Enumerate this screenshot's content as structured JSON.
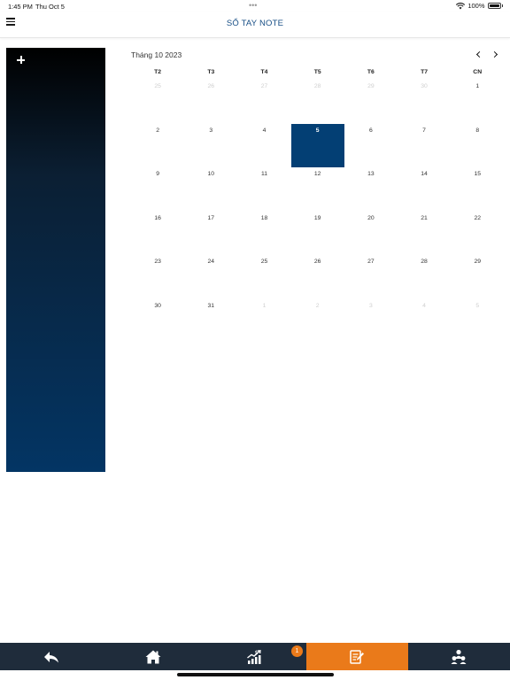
{
  "status_bar": {
    "time": "1:45 PM",
    "date": "Thu Oct 5",
    "battery": "100%"
  },
  "header": {
    "title": "SỔ TAY NOTE"
  },
  "calendar": {
    "month_label": "Tháng 10 2023",
    "weekdays": [
      "T2",
      "T3",
      "T4",
      "T5",
      "T6",
      "T7",
      "CN"
    ],
    "days": [
      {
        "d": "25",
        "muted": true
      },
      {
        "d": "26",
        "muted": true
      },
      {
        "d": "27",
        "muted": true
      },
      {
        "d": "28",
        "muted": true
      },
      {
        "d": "29",
        "muted": true
      },
      {
        "d": "30",
        "muted": true
      },
      {
        "d": "1"
      },
      {
        "d": "2"
      },
      {
        "d": "3"
      },
      {
        "d": "4"
      },
      {
        "d": "5",
        "selected": true
      },
      {
        "d": "6"
      },
      {
        "d": "7"
      },
      {
        "d": "8"
      },
      {
        "d": "9"
      },
      {
        "d": "10"
      },
      {
        "d": "11"
      },
      {
        "d": "12"
      },
      {
        "d": "13"
      },
      {
        "d": "14"
      },
      {
        "d": "15"
      },
      {
        "d": "16"
      },
      {
        "d": "17"
      },
      {
        "d": "18"
      },
      {
        "d": "19"
      },
      {
        "d": "20"
      },
      {
        "d": "21"
      },
      {
        "d": "22"
      },
      {
        "d": "23"
      },
      {
        "d": "24"
      },
      {
        "d": "25"
      },
      {
        "d": "26"
      },
      {
        "d": "27"
      },
      {
        "d": "28"
      },
      {
        "d": "29"
      },
      {
        "d": "30"
      },
      {
        "d": "31"
      },
      {
        "d": "1",
        "muted": true
      },
      {
        "d": "2",
        "muted": true
      },
      {
        "d": "3",
        "muted": true
      },
      {
        "d": "4",
        "muted": true
      },
      {
        "d": "5",
        "muted": true
      }
    ]
  },
  "tab_bar": {
    "items": [
      {
        "icon": "back-arrow-icon"
      },
      {
        "icon": "home-icon"
      },
      {
        "icon": "chart-dollar-icon"
      },
      {
        "icon": "notebook-pen-icon",
        "active": true
      },
      {
        "icon": "people-icon"
      }
    ],
    "badge": "1"
  },
  "colors": {
    "accent": "#ea7a1a",
    "selected": "#033f74",
    "tabbar": "#1f2c3b",
    "title": "#184f86"
  }
}
